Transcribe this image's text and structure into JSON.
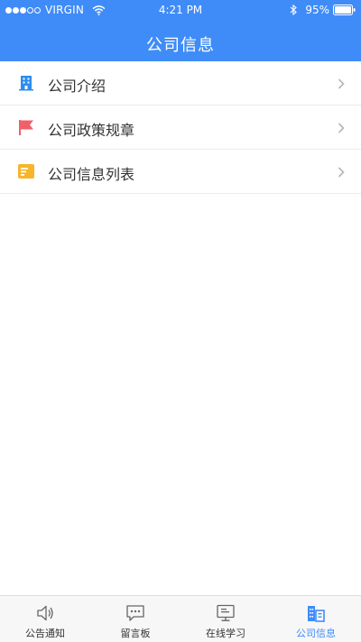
{
  "status_bar": {
    "carrier": "VIRGIN",
    "time": "4:21 PM",
    "battery": "95%",
    "signal_bars": 3,
    "signal_total": 5
  },
  "nav": {
    "title": "公司信息"
  },
  "menu": [
    {
      "label": "公司介绍",
      "icon": "building-icon",
      "color": "#2d8cf0"
    },
    {
      "label": "公司政策规章",
      "icon": "flag-icon",
      "color": "#f0606a"
    },
    {
      "label": "公司信息列表",
      "icon": "document-list-icon",
      "color": "#f7b52b"
    }
  ],
  "tabs": [
    {
      "label": "公告通知",
      "icon": "speaker-icon",
      "active": false
    },
    {
      "label": "留言板",
      "icon": "chat-bubble-icon",
      "active": false
    },
    {
      "label": "在线学习",
      "icon": "monitor-icon",
      "active": false
    },
    {
      "label": "公司信息",
      "icon": "company-building-icon",
      "active": true
    }
  ],
  "colors": {
    "accent": "#3f8cf8",
    "tab_inactive": "#333333",
    "divider": "#ececec"
  }
}
